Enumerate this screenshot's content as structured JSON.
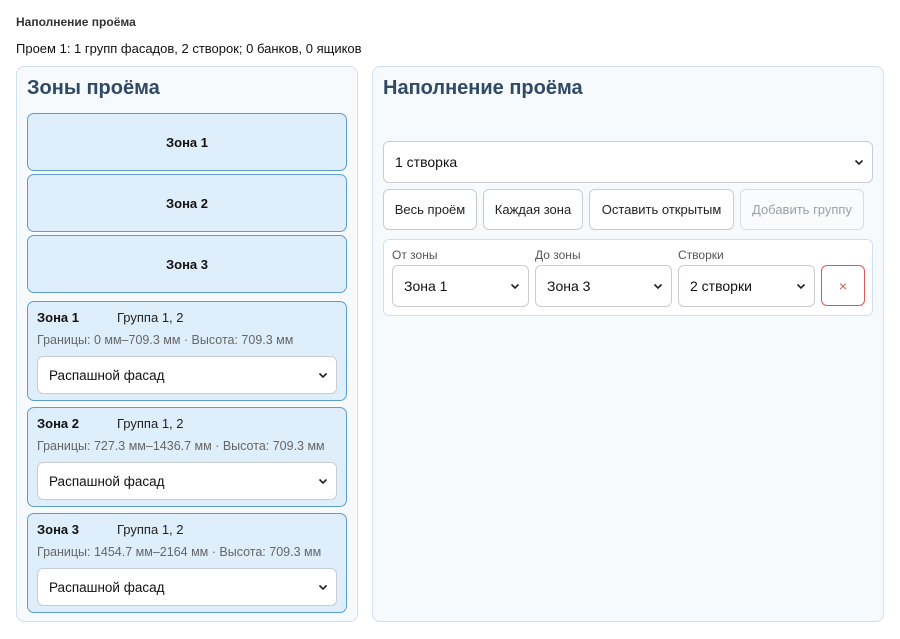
{
  "page": {
    "heading": "Наполнение проёма",
    "summary": "Проем 1: 1 групп фасадов, 2 створок; 0 банков, 0 ящиков"
  },
  "zones_panel": {
    "title": "Зоны проёма",
    "zone_buttons": [
      "Зона 1",
      "Зона 2",
      "Зона 3"
    ],
    "zone_cards": [
      {
        "name": "Зона 1",
        "group": "Группа 1, 2",
        "bounds": "Границы: 0 мм–709.3 мм · Высота: 709.3 мм",
        "facade": "Распашной фасад"
      },
      {
        "name": "Зона 2",
        "group": "Группа 1, 2",
        "bounds": "Границы: 727.3 мм–1436.7 мм · Высота: 709.3 мм",
        "facade": "Распашной фасад"
      },
      {
        "name": "Зона 3",
        "group": "Группа 1, 2",
        "bounds": "Границы: 1454.7 мм–2164 мм · Высота: 709.3 мм",
        "facade": "Распашной фасад"
      }
    ]
  },
  "fill_panel": {
    "title": "Наполнение проёма",
    "fill_select": "1 створка",
    "buttons": {
      "whole": "Весь проём",
      "each_zone": "Каждая зона",
      "leave_open": "Оставить открытым",
      "add_group": "Добавить группу"
    },
    "group": {
      "from_label": "От зоны",
      "from_value": "Зона 1",
      "to_label": "До зоны",
      "to_value": "Зона 3",
      "leaves_label": "Створки",
      "leaves_value": "2 створки",
      "delete_label": "×"
    }
  },
  "colors": {
    "accent": "#5d9cd3",
    "zone_bg": "#deeefb",
    "title": "#2f4a66",
    "danger": "#e05656"
  }
}
